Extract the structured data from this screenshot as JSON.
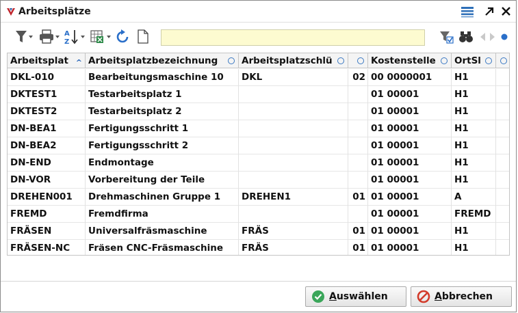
{
  "window": {
    "title": "Arbeitsplätze"
  },
  "search": {
    "value": ""
  },
  "table": {
    "columns": [
      {
        "label": "Arbeitsplat",
        "sort": "asc"
      },
      {
        "label": "Arbeitsplatzbezeichnung"
      },
      {
        "label": "Arbeitsplatzschlü"
      },
      {
        "label": ""
      },
      {
        "label": "Kostenstelle"
      },
      {
        "label": "OrtSl"
      },
      {
        "label": ""
      }
    ],
    "rows": [
      [
        "DKL-010",
        "Bearbeitungsmaschine 10",
        "DKL",
        "02",
        "00 0000001",
        "H1",
        ""
      ],
      [
        "DKTEST1",
        "Testarbeitsplatz 1",
        "",
        "",
        "01 00001",
        "H1",
        ""
      ],
      [
        "DKTEST2",
        "Testarbeitsplatz 2",
        "",
        "",
        "01 00001",
        "H1",
        ""
      ],
      [
        "DN-BEA1",
        "Fertigungsschritt 1",
        "",
        "",
        "01 00001",
        "H1",
        ""
      ],
      [
        "DN-BEA2",
        "Fertigungsschritt 2",
        "",
        "",
        "01 00001",
        "H1",
        ""
      ],
      [
        "DN-END",
        "Endmontage",
        "",
        "",
        "01 00001",
        "H1",
        ""
      ],
      [
        "DN-VOR",
        "Vorbereitung der Teile",
        "",
        "",
        "01 00001",
        "H1",
        ""
      ],
      [
        "DREHEN001",
        "Drehmaschinen Gruppe 1",
        "DREHEN1",
        "01",
        "01 00001",
        "A",
        ""
      ],
      [
        "FREMD",
        "Fremdfirma",
        "",
        "",
        "01 00001",
        "FREMD",
        ""
      ],
      [
        "FRÄSEN",
        "Universalfräsmaschine",
        "FRÄS",
        "01",
        "01 00001",
        "H1",
        ""
      ],
      [
        "FRÄSEN-NC",
        "Fräsen CNC-Fräsmaschine",
        "FRÄS",
        "01",
        "01 00001",
        "H1",
        ""
      ]
    ]
  },
  "buttons": {
    "select_pre": "",
    "select_mnemonic": "A",
    "select_post": "uswählen",
    "cancel_pre": "",
    "cancel_mnemonic": "A",
    "cancel_post": "bbrechen"
  },
  "colors": {
    "accent": "#2a6fc9",
    "ok_green": "#3aa65a",
    "cancel_red": "#d23b2b",
    "search_bg": "#fdfbd0"
  }
}
